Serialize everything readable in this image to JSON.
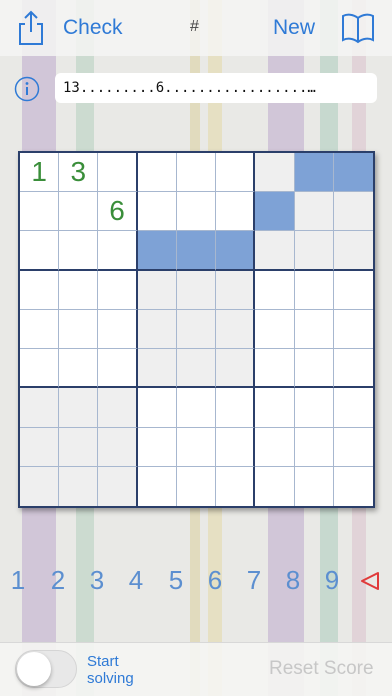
{
  "toolbar": {
    "share_icon": "share-icon",
    "check_label": "Check",
    "hash_label": "#",
    "new_label": "New",
    "book_icon": "book-icon"
  },
  "puzzle": {
    "info_icon": "info-icon",
    "code": "13.........6.................…"
  },
  "board": {
    "givens": [
      [
        "1",
        "3",
        "",
        "",
        "",
        "",
        "",
        "",
        ""
      ],
      [
        "",
        "",
        "6",
        "",
        "",
        "",
        "",
        "",
        ""
      ],
      [
        "",
        "",
        "",
        "",
        "",
        "",
        "",
        "",
        ""
      ],
      [
        "",
        "",
        "",
        "",
        "",
        "",
        "",
        "",
        ""
      ],
      [
        "",
        "",
        "",
        "",
        "",
        "",
        "",
        "",
        ""
      ],
      [
        "",
        "",
        "",
        "",
        "",
        "",
        "",
        "",
        ""
      ],
      [
        "",
        "",
        "",
        "",
        "",
        "",
        "",
        "",
        ""
      ],
      [
        "",
        "",
        "",
        "",
        "",
        "",
        "",
        "",
        ""
      ],
      [
        "",
        "",
        "",
        "",
        "",
        "",
        "",
        "",
        ""
      ]
    ],
    "highlighted_cells": [
      [
        0,
        7
      ],
      [
        0,
        8
      ],
      [
        1,
        6
      ],
      [
        2,
        3
      ],
      [
        2,
        4
      ],
      [
        2,
        5
      ]
    ],
    "shaded_boxes": [
      [
        0,
        6
      ],
      [
        3,
        3
      ],
      [
        6,
        0
      ]
    ],
    "colors": {
      "given": "#3a8e3a",
      "highlight": "#7ea2d6",
      "shade": "#efefef",
      "box_border": "#2b3f6a"
    }
  },
  "numpad": {
    "digits": [
      "1",
      "2",
      "3",
      "4",
      "5",
      "6",
      "7",
      "8",
      "9"
    ],
    "erase_icon": "erase-triangle-icon",
    "digit_color": "#5c8fd0",
    "erase_color": "#e03a3a"
  },
  "bottom": {
    "toggle_line1": "Start",
    "toggle_line2": "solving",
    "toggle_on": false,
    "reset_label": "Reset Score"
  }
}
